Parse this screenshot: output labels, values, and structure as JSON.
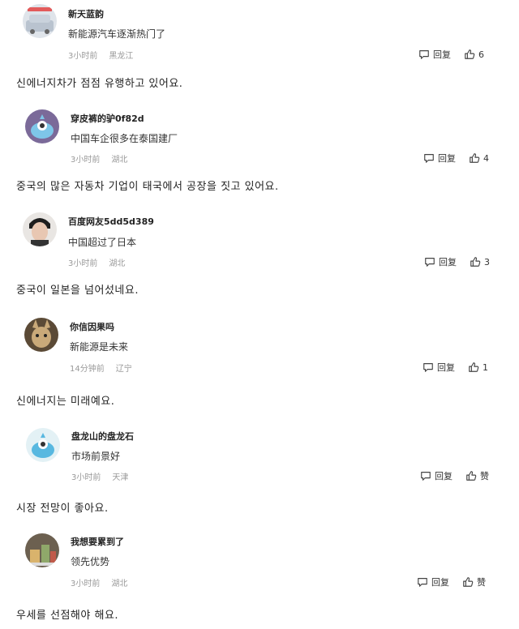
{
  "comments": [
    {
      "name": "新天蓝韵",
      "text": "新能源汽车逐渐热门了",
      "time": "3小时前",
      "location": "黑龙江",
      "reply": "回复",
      "likes": "6",
      "avatar": "car-photo-avatar",
      "translation": "신에너지차가 점점 유행하고 있어요."
    },
    {
      "name": "穿皮裤的驴0f82d",
      "text": "中国车企很多在泰国建厂",
      "time": "3小时前",
      "location": "湖北",
      "reply": "回复",
      "likes": "4",
      "avatar": "alien-cartoon-avatar",
      "translation": "중국의 많은 자동차 기업이 태국에서 공장을 짓고 있어요."
    },
    {
      "name": "百度网友5dd5d389",
      "text": "中国超过了日本",
      "time": "3小时前",
      "location": "湖北",
      "reply": "回复",
      "likes": "3",
      "avatar": "person-photo-avatar",
      "translation": "중국이 일본을 넘어섰네요."
    },
    {
      "name": "你信因果吗",
      "text": "新能源是未来",
      "time": "14分钟前",
      "location": "辽宁",
      "reply": "回复",
      "likes": "1",
      "avatar": "animal-photo-avatar",
      "translation": "신에너지는 미래예요."
    },
    {
      "name": "盘龙山的盘龙石",
      "text": "市场前景好",
      "time": "3小时前",
      "location": "天津",
      "reply": "回复",
      "likes": "赞",
      "avatar": "alien-cartoon-avatar-blue",
      "translation": "시장 전망이 좋아요."
    },
    {
      "name": "我想要累到了",
      "text": "领先优势",
      "time": "3小时前",
      "location": "湖北",
      "reply": "回复",
      "likes": "赞",
      "avatar": "objects-photo-avatar",
      "translation": "우세를 선점해야 해요."
    }
  ]
}
